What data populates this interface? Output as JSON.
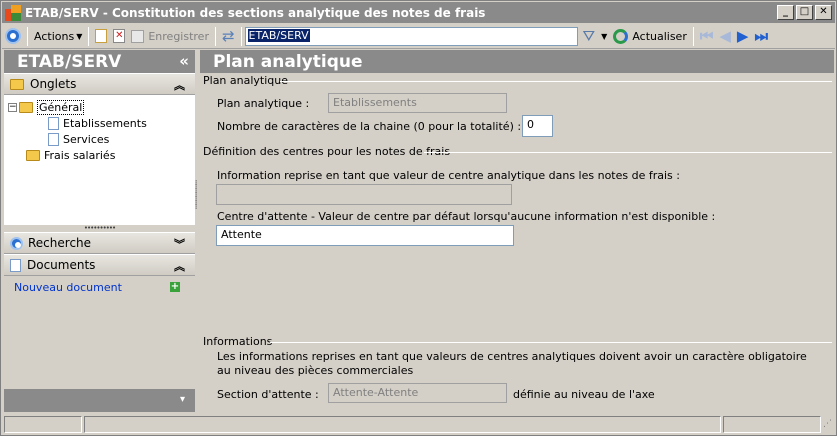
{
  "window": {
    "title": "ETAB/SERV -  Constitution des sections analytique des notes de frais",
    "btn_min": "_",
    "btn_max": "□",
    "btn_close": "✕"
  },
  "toolbar": {
    "actions_label": "Actions",
    "save_label": "Enregistrer",
    "search_value": "ETAB/SERV",
    "refresh_label": "Actualiser"
  },
  "left": {
    "title": "ETAB/SERV",
    "collapse_glyph": "«",
    "onglets_label": "Onglets",
    "tree": {
      "general": "Général",
      "etablissements": "Etablissements",
      "services": "Services",
      "frais": "Frais salariés"
    },
    "splitter": "••••••••••",
    "recherche_label": "Recherche",
    "documents_label": "Documents",
    "new_document": "Nouveau document",
    "chev_up": "︽",
    "chev_down": "︾",
    "chev_small": "▾"
  },
  "main": {
    "title": "Plan analytique",
    "group1": {
      "title": "Plan analytique",
      "plan_label": "Plan analytique :",
      "plan_value": "Etablissements",
      "nb_label": "Nombre de caractères de la chaine (0 pour la totalité) :",
      "nb_value": "0"
    },
    "group2": {
      "title": "Définition des centres pour les notes de frais",
      "info_label": "Information reprise en tant que valeur de centre analytique dans les notes de frais :",
      "info_value": "",
      "centre_label": "Centre d'attente - Valeur de centre par défaut lorsqu'aucune information n'est disponible :",
      "centre_value": "Attente"
    },
    "group3": {
      "title": "Informations",
      "text1": "Les informations reprises en tant que valeurs de centres analytiques doivent avoir un caractère obligatoire",
      "text2": "au niveau des pièces commerciales",
      "section_label": "Section d'attente :",
      "section_value": "Attente-Attente",
      "section_suffix": "définie au niveau de l'axe"
    }
  },
  "colors": {
    "header_bg": "#8a8a8a",
    "window_bg": "#d4d0c8",
    "link": "#0033cc",
    "accent": "#2060d0"
  }
}
